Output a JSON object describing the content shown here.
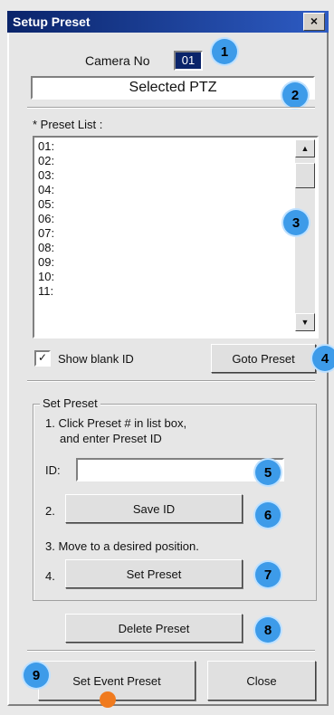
{
  "window": {
    "title": "Setup Preset",
    "close_glyph": "×"
  },
  "camera": {
    "label": "Camera No",
    "value": "01"
  },
  "selected": {
    "label": "Selected PTZ"
  },
  "preset_list": {
    "label": "* Preset List :",
    "items": [
      "01:",
      "02:",
      "03:",
      "04:",
      "05:",
      "06:",
      "07:",
      "08:",
      "09:",
      "10:",
      "11:"
    ]
  },
  "show_blank": {
    "label": "Show blank ID",
    "checked": true
  },
  "goto_button": {
    "label": "Goto Preset"
  },
  "set_preset_group": {
    "title": "Set Preset",
    "step1_line1": "1. Click Preset # in list box,",
    "step1_line2": "and enter Preset ID",
    "id_label": "ID:",
    "id_value": "",
    "step2": "2.",
    "save_id": "Save ID",
    "step3": "3. Move to a desired position.",
    "step4": "4.",
    "set_preset": "Set Preset"
  },
  "delete_button": {
    "label": "Delete Preset"
  },
  "event_button": {
    "label": "Set Event Preset"
  },
  "close_button": {
    "label": "Close"
  },
  "badges": [
    "1",
    "2",
    "3",
    "4",
    "5",
    "6",
    "7",
    "8",
    "9"
  ],
  "colors": {
    "titlebar": "#0a246a",
    "badge": "#3d9be9",
    "cursor_dot": "#f07b1f"
  }
}
